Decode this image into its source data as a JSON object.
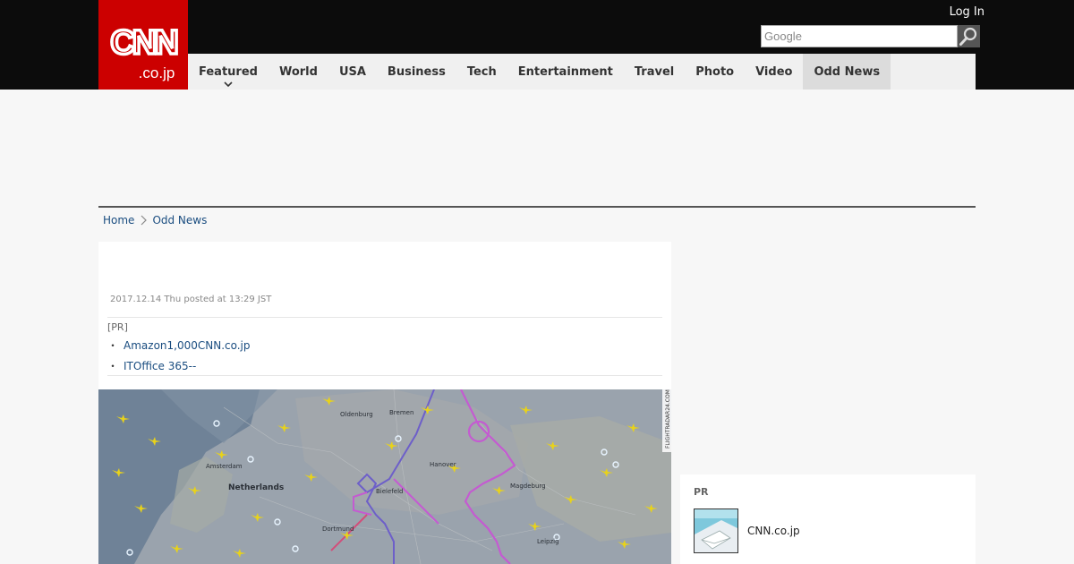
{
  "header": {
    "logo_alt": "CNN.co.jp",
    "login_label": "Log In",
    "search_placeholder": "Google",
    "colors": {
      "brand": "#cc0000",
      "bar": "#0c0c0c"
    }
  },
  "nav": {
    "items": [
      {
        "label": "Featured",
        "has_dropdown": true
      },
      {
        "label": "World"
      },
      {
        "label": "USA"
      },
      {
        "label": "Business"
      },
      {
        "label": "Tech"
      },
      {
        "label": "Entertainment"
      },
      {
        "label": "Travel"
      },
      {
        "label": "Photo"
      },
      {
        "label": "Video"
      },
      {
        "label": "Odd News",
        "active": true
      }
    ]
  },
  "breadcrumb": {
    "home": "Home",
    "current": "Odd News"
  },
  "article": {
    "posted": "2017.12.14 Thu posted at 13:29 JST",
    "pr_tag": "[PR]",
    "pr_links": [
      "Amazon1,000CNN.co.jp",
      "ITOffice 365--"
    ],
    "image": {
      "icon": "flight-map-image",
      "watermark": "FLIGHTRADAR24.COM",
      "labels": [
        "Oldenburg",
        "Bremen",
        "Netherlands",
        "Amsterdam",
        "Hanover",
        "Bielefeld",
        "Dortmund",
        "Magdeburg",
        "Leipzig"
      ]
    }
  },
  "sidebar": {
    "pr_tag": "PR",
    "link_label": "CNN.co.jp"
  }
}
